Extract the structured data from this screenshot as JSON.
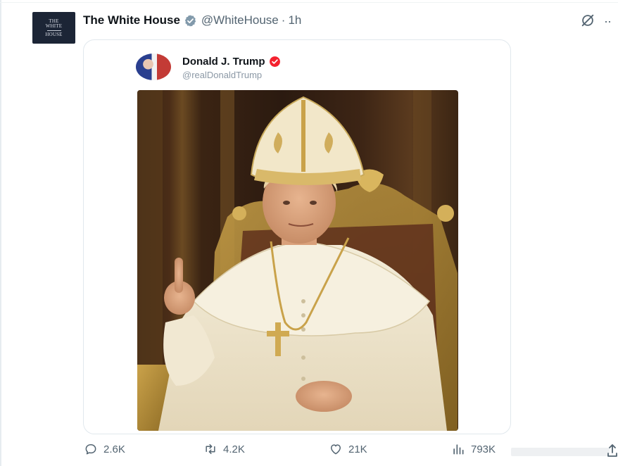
{
  "post": {
    "author_name": "The White House",
    "author_handle": "@WhiteHouse",
    "separator": "·",
    "time": "1h",
    "avatar_lines": [
      "THE",
      "WHITE",
      "HOUSE"
    ],
    "icons": {
      "verified": "verified-badge-gray-icon",
      "grok": "grok-icon",
      "more": "more-options-icon"
    }
  },
  "quoted": {
    "author_name": "Donald J. Trump",
    "author_handle": "@realDonaldTrump",
    "verified_color": "#f4212e"
  },
  "image": {
    "subject": "figure in white papal vestments and gold mitre seated on a gilded throne, right index finger raised"
  },
  "actions": {
    "replies": "2.6K",
    "retweets": "4.2K",
    "likes": "21K",
    "views": "793K"
  },
  "colors": {
    "text_primary": "#0f1419",
    "text_secondary": "#536471",
    "border": "#e1e8ed"
  }
}
